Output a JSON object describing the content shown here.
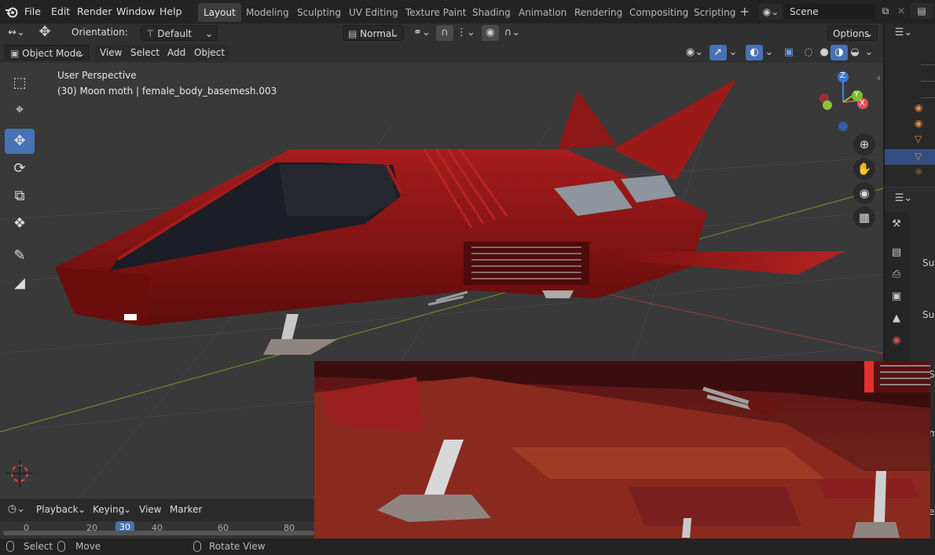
{
  "top_menu": [
    "File",
    "Edit",
    "Render",
    "Window",
    "Help"
  ],
  "workspaces": [
    {
      "label": "Layout",
      "active": true
    },
    {
      "label": "Modeling",
      "active": false
    },
    {
      "label": "Sculpting",
      "active": false
    },
    {
      "label": "UV Editing",
      "active": false
    },
    {
      "label": "Texture Paint",
      "active": false
    },
    {
      "label": "Shading",
      "active": false
    },
    {
      "label": "Animation",
      "active": false
    },
    {
      "label": "Rendering",
      "active": false
    },
    {
      "label": "Compositing",
      "active": false
    },
    {
      "label": "Scripting",
      "active": false
    }
  ],
  "scene": {
    "value": "Scene"
  },
  "tool_header": {
    "orientation_label": "Orientation:",
    "orientation_value": "Default",
    "pivot_value": "Normal",
    "options_label": "Options"
  },
  "viewport_header": {
    "mode": "Object Mode",
    "menus": [
      "View",
      "Select",
      "Add",
      "Object"
    ]
  },
  "viewport": {
    "perspective": "User Perspective",
    "object_info": "(30) Moon moth | female_body_basemesh.003"
  },
  "gizmo": {
    "z": "Z",
    "y": "Y",
    "x": "X"
  },
  "timeline": {
    "menus": [
      "Playback",
      "Keying",
      "View",
      "Marker"
    ],
    "ticks": [
      "0",
      "20",
      "30",
      "40",
      "60",
      "80"
    ],
    "current_frame": "30"
  },
  "statusbar": {
    "select": "Select",
    "move": "Move",
    "rotate": "Rotate View"
  },
  "props_labels": [
    "Sub",
    "Sub",
    "Sp",
    "mi",
    "e"
  ],
  "colors": {
    "accent": "#4772b3",
    "hull": "#8c1414",
    "outliner_sel": "#334d80"
  }
}
